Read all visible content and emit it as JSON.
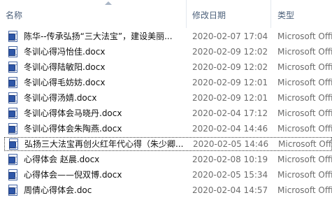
{
  "columns": {
    "name": "名称",
    "date": "修改日期",
    "type": "类型"
  },
  "files": [
    {
      "name": "陈华--传承弘扬“三大法宝”，建设美丽...",
      "date": "2020-02-07 17:04",
      "type": "Microsoft Office"
    },
    {
      "name": "冬训心得冯怡佳.docx",
      "date": "2020-02-09 12:02",
      "type": "Microsoft Office"
    },
    {
      "name": "冬训心得陆敏阳.docx",
      "date": "2020-02-09 12:02",
      "type": "Microsoft Office"
    },
    {
      "name": "冬训心得毛妨妨.docx",
      "date": "2020-02-09 12:01",
      "type": "Microsoft Office"
    },
    {
      "name": "冬训心得汤婧.docx",
      "date": "2020-02-09 12:01",
      "type": "Microsoft Office"
    },
    {
      "name": "冬训心得体会马晓丹.docx",
      "date": "2020-02-04 17:12",
      "type": "Microsoft Office"
    },
    {
      "name": "冬训心得体会朱陶燕.docx",
      "date": "2020-02-04 14:46",
      "type": "Microsoft Office"
    },
    {
      "name": "弘扬三大法宝再创火红年代心得（朱少卿...",
      "date": "2020-02-05 14:46",
      "type": "Microsoft Office",
      "selected": true
    },
    {
      "name": "心得体会 赵晨.docx",
      "date": "2020-02-08 10:19",
      "type": "Microsoft Office"
    },
    {
      "name": "心得体会——倪双博.docx",
      "date": "2020-02-05 15:34",
      "type": "Microsoft Office"
    },
    {
      "name": "周倩心得体会.doc",
      "date": "2020-02-04 14:57",
      "type": "Microsoft Office"
    }
  ]
}
